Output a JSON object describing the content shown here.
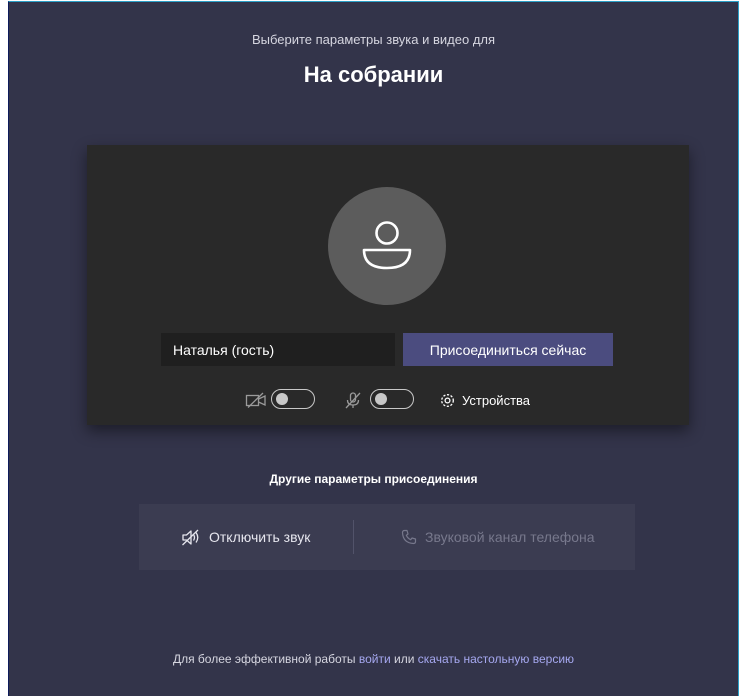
{
  "header": {
    "subtitle": "Выберите параметры звука и видео для",
    "title": "На собрании"
  },
  "preview": {
    "avatar_icon": "person-icon",
    "name_value": "Наталья (гость)",
    "join_label": "Присоединиться сейчас",
    "camera_icon": "camera-off-icon",
    "camera_on": false,
    "mic_icon": "mic-off-icon",
    "mic_on": false,
    "devices_icon": "gear-icon",
    "devices_label": "Устройства"
  },
  "other": {
    "title": "Другие параметры присоединения",
    "mute_icon": "speaker-off-icon",
    "mute_label": "Отключить звук",
    "phone_icon": "phone-icon",
    "phone_label": "Звуковой канал телефона"
  },
  "footer": {
    "prefix": "Для более эффективной работы",
    "login_link": "войти",
    "middle": "или",
    "download_link": "скачать настольную версию"
  },
  "colors": {
    "background": "#33344a",
    "preview_bg": "#292929",
    "accent": "#4b4c7f",
    "link": "#a6a8f0"
  }
}
